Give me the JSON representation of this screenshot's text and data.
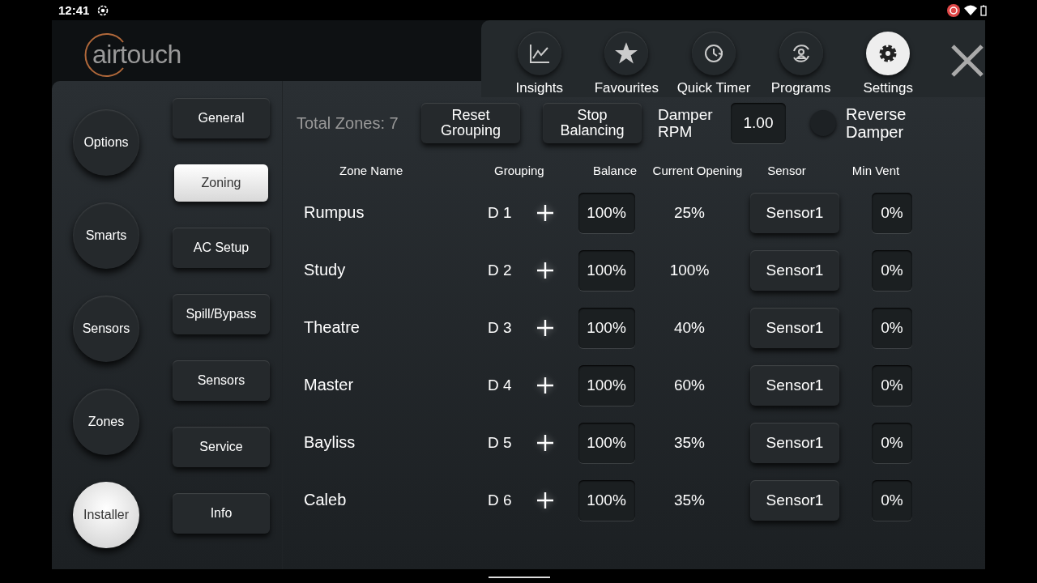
{
  "status_bar": {
    "time": "12:41"
  },
  "logo": {
    "text": "airtouch"
  },
  "nav": [
    {
      "label": "Insights",
      "selected": false
    },
    {
      "label": "Favourites",
      "selected": false
    },
    {
      "label": "Quick Timer",
      "selected": false
    },
    {
      "label": "Programs",
      "selected": false
    },
    {
      "label": "Settings",
      "selected": true
    }
  ],
  "side_menu": [
    {
      "label": "Options",
      "selected": false
    },
    {
      "label": "Smarts",
      "selected": false
    },
    {
      "label": "Sensors",
      "selected": false
    },
    {
      "label": "Zones",
      "selected": false
    },
    {
      "label": "Installer",
      "selected": true
    }
  ],
  "sub_menu": [
    {
      "label": "General",
      "selected": false
    },
    {
      "label": "Zoning",
      "selected": true
    },
    {
      "label": "AC Setup",
      "selected": false
    },
    {
      "label": "Spill/Bypass",
      "selected": false
    },
    {
      "label": "Sensors",
      "selected": false
    },
    {
      "label": "Service",
      "selected": false
    },
    {
      "label": "Info",
      "selected": false
    }
  ],
  "toolbar": {
    "total_zones": "Total Zones: 7",
    "reset_button": "Reset Grouping",
    "stop_button": "Stop Balancing",
    "damper_rpm_label": "Damper RPM",
    "damper_rpm_value": "1.00",
    "reverse_damper": {
      "label": "Reverse Damper",
      "on": false
    }
  },
  "table": {
    "columns": [
      "Zone Name",
      "Grouping",
      "Balance",
      "Current Opening",
      "Sensor",
      "Min Vent"
    ],
    "rows": [
      {
        "name": "Rumpus",
        "group": "D 1",
        "balance": "100%",
        "opening": "25%",
        "sensor": "Sensor1",
        "min_vent": "0%"
      },
      {
        "name": "Study",
        "group": "D 2",
        "balance": "100%",
        "opening": "100%",
        "sensor": "Sensor1",
        "min_vent": "0%"
      },
      {
        "name": "Theatre",
        "group": "D 3",
        "balance": "100%",
        "opening": "40%",
        "sensor": "Sensor1",
        "min_vent": "0%"
      },
      {
        "name": "Master",
        "group": "D 4",
        "balance": "100%",
        "opening": "60%",
        "sensor": "Sensor1",
        "min_vent": "0%"
      },
      {
        "name": "Bayliss",
        "group": "D 5",
        "balance": "100%",
        "opening": "35%",
        "sensor": "Sensor1",
        "min_vent": "0%"
      },
      {
        "name": "Caleb",
        "group": "D 6",
        "balance": "100%",
        "opening": "35%",
        "sensor": "Sensor1",
        "min_vent": "0%"
      }
    ]
  }
}
